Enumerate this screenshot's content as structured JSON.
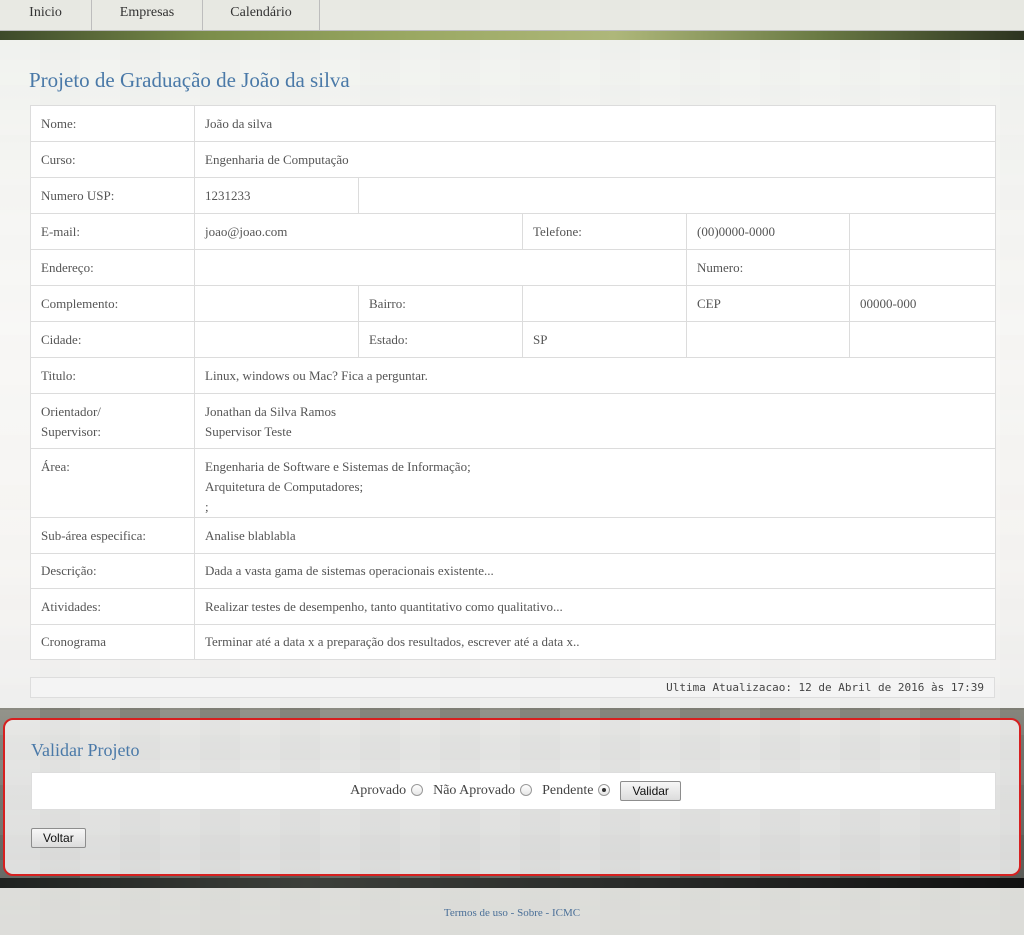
{
  "nav": {
    "tabs": [
      "Inicio",
      "Empresas",
      "Calendário"
    ]
  },
  "page_title": "Projeto de Graduação de João da silva",
  "info": {
    "nome_label": "Nome:",
    "nome": "João da silva",
    "curso_label": "Curso:",
    "curso": "Engenharia de Computação",
    "nusp_label": "Numero USP:",
    "nusp": "1231233",
    "email_label": "E-mail:",
    "email": "joao@joao.com",
    "telefone_label": "Telefone:",
    "telefone": "(00)0000-0000",
    "endereco_label": "Endereço:",
    "endereco": "",
    "numero_label": "Numero:",
    "numero": "",
    "complemento_label": "Complemento:",
    "complemento": "",
    "bairro_label": "Bairro:",
    "bairro": "",
    "cep_label": "CEP",
    "cep": "00000-000",
    "cidade_label": "Cidade:",
    "cidade": "",
    "estado_label": "Estado:",
    "estado": "SP",
    "titulo_label": "Titulo:",
    "titulo": "Linux, windows ou Mac? Fica a perguntar.",
    "orientador_label_1": "Orientador/",
    "orientador_label_2": "Supervisor:",
    "orientador": "Jonathan da Silva Ramos",
    "supervisor": "Supervisor Teste",
    "area_label": "Área:",
    "area_1": "Engenharia de Software e Sistemas de Informação;",
    "area_2": "Arquitetura de Computadores;",
    "area_3": ";",
    "subarea_label": "Sub-área especifica:",
    "subarea": "Analise blablabla",
    "descricao_label": "Descrição:",
    "descricao": "Dada a vasta gama de sistemas operacionais existente...",
    "atividades_label": "Atividades:",
    "atividades": "Realizar testes de desempenho, tanto quantitativo como qualitativo...",
    "cronograma_label": "Cronograma",
    "cronograma": "Terminar até a data x a preparação dos resultados, escrever até a data x.."
  },
  "updated": "Ultima Atualizacao: 12 de Abril de 2016 às 17:39",
  "validate": {
    "title": "Validar Projeto",
    "options": [
      "Aprovado",
      "Não Aprovado",
      "Pendente"
    ],
    "selected": "Pendente",
    "submit_label": "Validar",
    "back_label": "Voltar"
  },
  "footer": {
    "terms": "Termos de uso",
    "about": "Sobre",
    "icmc": "ICMC",
    "separator": "-"
  },
  "colors": {
    "title_blue": "#4a79a8",
    "highlight_red": "#d62020"
  }
}
